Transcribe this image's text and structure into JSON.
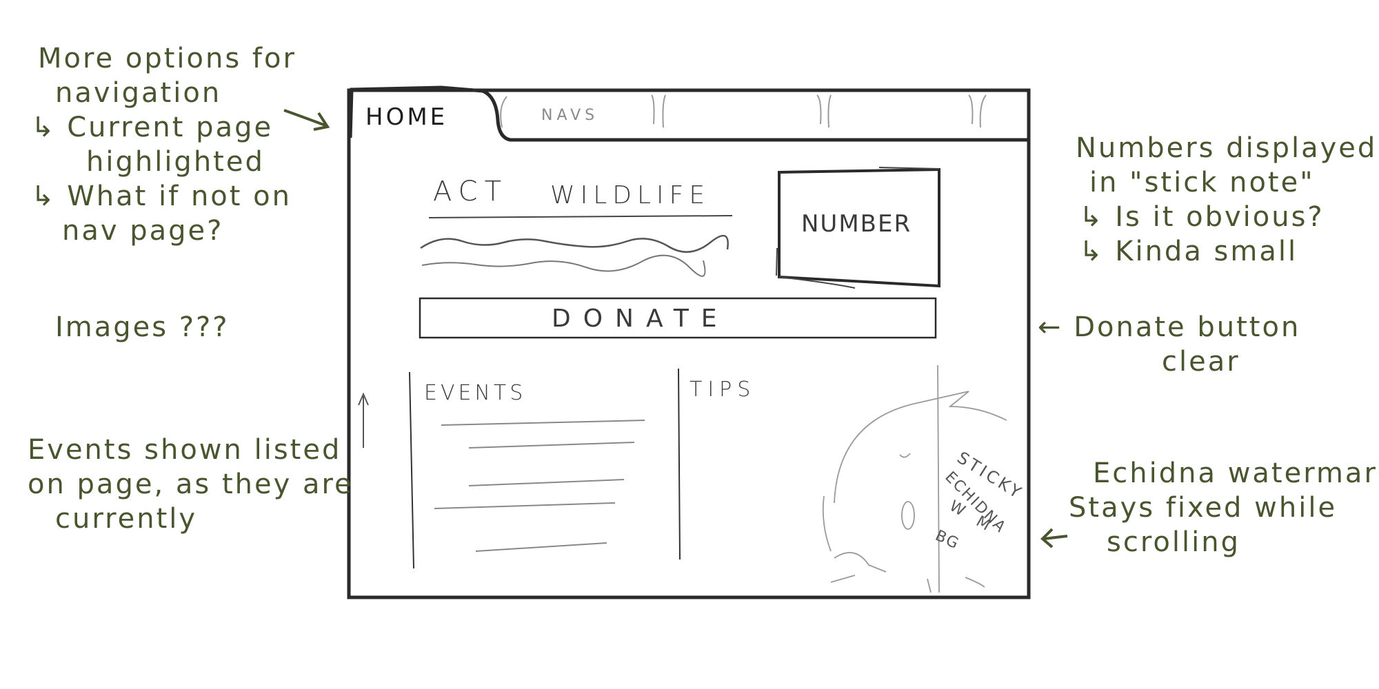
{
  "colors": {
    "ink": "#49552e",
    "pencil": "#333333",
    "light": "#9a9a9a"
  },
  "annotations": {
    "nav": {
      "lines": [
        "More options for",
        "navigation",
        "↳ Current page",
        "highlighted",
        "↳ What if not on",
        "nav page?"
      ]
    },
    "images": "Images ???",
    "events": {
      "lines": [
        "Events shown listed",
        "on page, as they are",
        "currently"
      ]
    },
    "numbers": {
      "lines": [
        "Numbers displayed",
        "in \"stick note\"",
        "↳ Is it obvious?",
        "↳ Kinda small"
      ]
    },
    "donate": {
      "lines": [
        "← Donate button",
        "clear"
      ]
    },
    "echidna": {
      "lines": [
        "Echidna watermark,",
        "Stays fixed while",
        "scrolling"
      ]
    }
  },
  "mockup": {
    "tab_home": "HOME",
    "tab_navs": "NAVS",
    "heading_left": "ACT",
    "heading_right": "WILDLIFE",
    "number_box": "NUMBER",
    "donate_button": "DONATE",
    "events_title": "EVENTS",
    "tips_title": "TIPS",
    "watermark_lines": [
      "STICKY",
      "ECHIDNA",
      "W M",
      "BG"
    ]
  }
}
